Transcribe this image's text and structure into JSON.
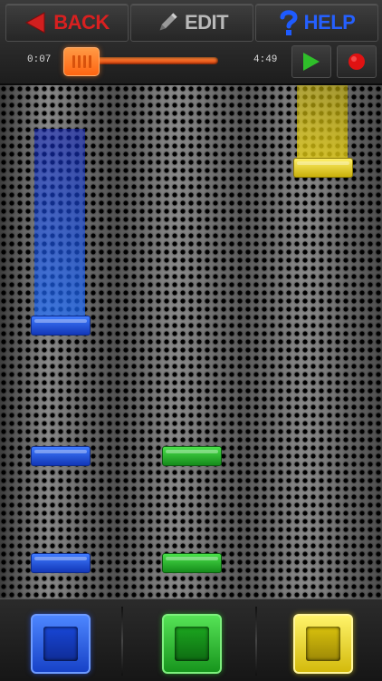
{
  "toolbar": {
    "back_label": "BACK",
    "edit_label": "EDIT",
    "help_label": "HELP"
  },
  "playback": {
    "elapsed": "0:07",
    "total": "4:49",
    "progress": 0.024
  },
  "icons": {
    "back": "back-arrow-icon",
    "edit": "pencil-icon",
    "help": "question-mark-icon",
    "play": "play-icon",
    "record": "record-icon"
  },
  "lanes": [
    {
      "color": "blue",
      "hex": "#1e5bff"
    },
    {
      "color": "green",
      "hex": "#27c42c"
    },
    {
      "color": "yellow",
      "hex": "#f2dd10"
    }
  ],
  "colors": {
    "back": "#d21f1f",
    "help": "#1e5bff",
    "slider": "#ff6512",
    "play": "#2fbf2a",
    "record": "#e01212"
  }
}
